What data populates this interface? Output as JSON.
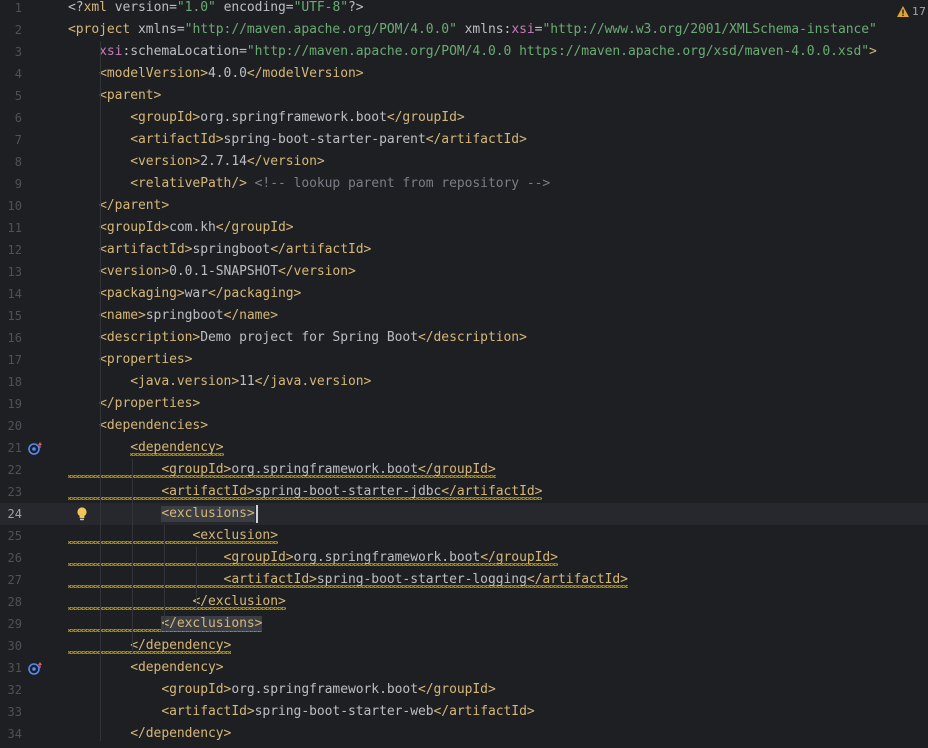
{
  "editor": {
    "warning_badge": {
      "icon": "warning-triangle-icon",
      "count": "17",
      "color": "#e0a33b"
    },
    "current_line": 24,
    "lines": [
      {
        "n": "1",
        "html": "<span class='p'>&lt;?</span><span class='t'>xml</span> <span class='a'>version</span>=<span class='s'>\"1.0\"</span> <span class='a'>encoding</span>=<span class='s'>\"UTF-8\"</span><span class='p'>?&gt;</span>"
      },
      {
        "n": "2",
        "html": "<span class='t'>&lt;project</span> <span class='a'>xmlns</span>=<span class='s'>\"http://maven.apache.org/POM/4.0.0\"</span> <span class='a'>xmlns</span>:<span class='ns'>xsi</span>=<span class='s'>\"http://www.w3.org/2001/XMLSchema-instance\"</span>"
      },
      {
        "n": "3",
        "html": "    <span class='ns'>xsi</span>:<span class='a'>schemaLocation</span>=<span class='s'>\"http://maven.apache.org/POM/4.0.0 https://maven.apache.org/xsd/maven-4.0.0.xsd\"</span><span class='t'>&gt;</span>"
      },
      {
        "n": "4",
        "html": "    <span class='t'>&lt;modelVersion&gt;</span><span class='tx'>4.0.0</span><span class='t'>&lt;/modelVersion&gt;</span>"
      },
      {
        "n": "5",
        "html": "    <span class='t'>&lt;parent&gt;</span>"
      },
      {
        "n": "6",
        "html": "        <span class='t'>&lt;groupId&gt;</span><span class='tx'>org.springframework.boot</span><span class='t'>&lt;/groupId&gt;</span>"
      },
      {
        "n": "7",
        "html": "        <span class='t'>&lt;artifactId&gt;</span><span class='tx'>spring-boot-starter-parent</span><span class='t'>&lt;/artifactId&gt;</span>"
      },
      {
        "n": "8",
        "html": "        <span class='t'>&lt;version&gt;</span><span class='tx'>2.7.14</span><span class='t'>&lt;/version&gt;</span>"
      },
      {
        "n": "9",
        "html": "        <span class='t'>&lt;relativePath/&gt;</span> <span class='c'>&lt;!-- lookup parent from repository --&gt;</span>"
      },
      {
        "n": "10",
        "html": "    <span class='t'>&lt;/parent&gt;</span>"
      },
      {
        "n": "11",
        "html": "    <span class='t'>&lt;groupId&gt;</span><span class='tx'>com.kh</span><span class='t'>&lt;/groupId&gt;</span>"
      },
      {
        "n": "12",
        "html": "    <span class='t'>&lt;artifactId&gt;</span><span class='tx'>springboot</span><span class='t'>&lt;/artifactId&gt;</span>"
      },
      {
        "n": "13",
        "html": "    <span class='t'>&lt;version&gt;</span><span class='tx'>0.0.1-SNAPSHOT</span><span class='t'>&lt;/version&gt;</span>"
      },
      {
        "n": "14",
        "html": "    <span class='t'>&lt;packaging&gt;</span><span class='tx'>war</span><span class='t'>&lt;/packaging&gt;</span>"
      },
      {
        "n": "15",
        "html": "    <span class='t'>&lt;name&gt;</span><span class='tx'>springboot</span><span class='t'>&lt;/name&gt;</span>"
      },
      {
        "n": "16",
        "html": "    <span class='t'>&lt;description&gt;</span><span class='tx'>Demo project for Spring Boot</span><span class='t'>&lt;/description&gt;</span>"
      },
      {
        "n": "17",
        "html": "    <span class='t'>&lt;properties&gt;</span>"
      },
      {
        "n": "18",
        "html": "        <span class='t'>&lt;java.version&gt;</span><span class='tx'>11</span><span class='t'>&lt;/java.version&gt;</span>"
      },
      {
        "n": "19",
        "html": "    <span class='t'>&lt;/properties&gt;</span>"
      },
      {
        "n": "20",
        "html": "    <span class='t'>&lt;dependencies&gt;</span>"
      },
      {
        "n": "21",
        "html": "        <span class='squig'><span class='t'>&lt;dependency&gt;</span></span>",
        "icon": "override-icon"
      },
      {
        "n": "22",
        "html": "<span class='squig'>            <span class='t'>&lt;groupId&gt;</span><span class='tx'>org.springframework.boot</span><span class='t'>&lt;/groupId&gt;</span></span>"
      },
      {
        "n": "23",
        "html": "<span class='squig'>            <span class='t'>&lt;artifactId&gt;</span><span class='tx'>spring-boot-starter-jdbc</span><span class='t'>&lt;/artifactId&gt;</span></span>"
      },
      {
        "n": "24",
        "html": "            <span class='squig hl-match'><span class='t'>&lt;exclusions&gt;</span></span>",
        "bulb": true
      },
      {
        "n": "25",
        "html": "<span class='squig'>                <span class='t'>&lt;exclusion&gt;</span></span>"
      },
      {
        "n": "26",
        "html": "<span class='squig'>                    <span class='t'>&lt;groupId&gt;</span><span class='tx'>org.springframework.boot</span><span class='t'>&lt;/groupId&gt;</span></span>"
      },
      {
        "n": "27",
        "html": "<span class='squig'>                    <span class='t'>&lt;artifactId&gt;</span><span class='tx'>spring-boot-starter-logging</span><span class='t'>&lt;/artifactId&gt;</span></span>"
      },
      {
        "n": "28",
        "html": "<span class='squig'>                <span class='t'>&lt;/exclusion&gt;</span></span>"
      },
      {
        "n": "29",
        "html": "<span class='squig'>            <span class='hl-match'><span class='t'>&lt;/exclusions&gt;</span></span></span>"
      },
      {
        "n": "30",
        "html": "<span class='squig'>        <span class='t'>&lt;/dependency&gt;</span></span>"
      },
      {
        "n": "31",
        "html": "        <span class='t'>&lt;dependency&gt;</span>",
        "icon": "override-icon"
      },
      {
        "n": "32",
        "html": "            <span class='t'>&lt;groupId&gt;</span><span class='tx'>org.springframework.boot</span><span class='t'>&lt;/groupId&gt;</span>"
      },
      {
        "n": "33",
        "html": "            <span class='t'>&lt;artifactId&gt;</span><span class='tx'>spring-boot-starter-web</span><span class='t'>&lt;/artifactId&gt;</span>"
      },
      {
        "n": "34",
        "html": "        <span class='t'>&lt;/dependency&gt;</span>"
      }
    ]
  }
}
